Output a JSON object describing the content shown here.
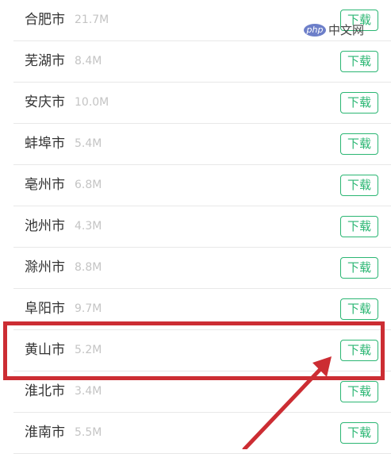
{
  "watermark": {
    "logo": "php",
    "text": "中文网"
  },
  "rows": [
    {
      "city": "合肥市",
      "size": "21.7M",
      "button": "下载"
    },
    {
      "city": "芜湖市",
      "size": "8.4M",
      "button": "下载"
    },
    {
      "city": "安庆市",
      "size": "10.0M",
      "button": "下载"
    },
    {
      "city": "蚌埠市",
      "size": "5.4M",
      "button": "下载"
    },
    {
      "city": "亳州市",
      "size": "6.8M",
      "button": "下载"
    },
    {
      "city": "池州市",
      "size": "4.3M",
      "button": "下载"
    },
    {
      "city": "滁州市",
      "size": "8.8M",
      "button": "下载"
    },
    {
      "city": "阜阳市",
      "size": "9.7M",
      "button": "下载"
    },
    {
      "city": "黄山市",
      "size": "5.2M",
      "button": "下载"
    },
    {
      "city": "淮北市",
      "size": "3.4M",
      "button": "下载"
    },
    {
      "city": "淮南市",
      "size": "5.5M",
      "button": "下载"
    }
  ],
  "colors": {
    "accent": "#2bb673",
    "highlight_annotation": "#cc2d33",
    "size_text": "#c4c4c4",
    "city_text": "#333333"
  }
}
